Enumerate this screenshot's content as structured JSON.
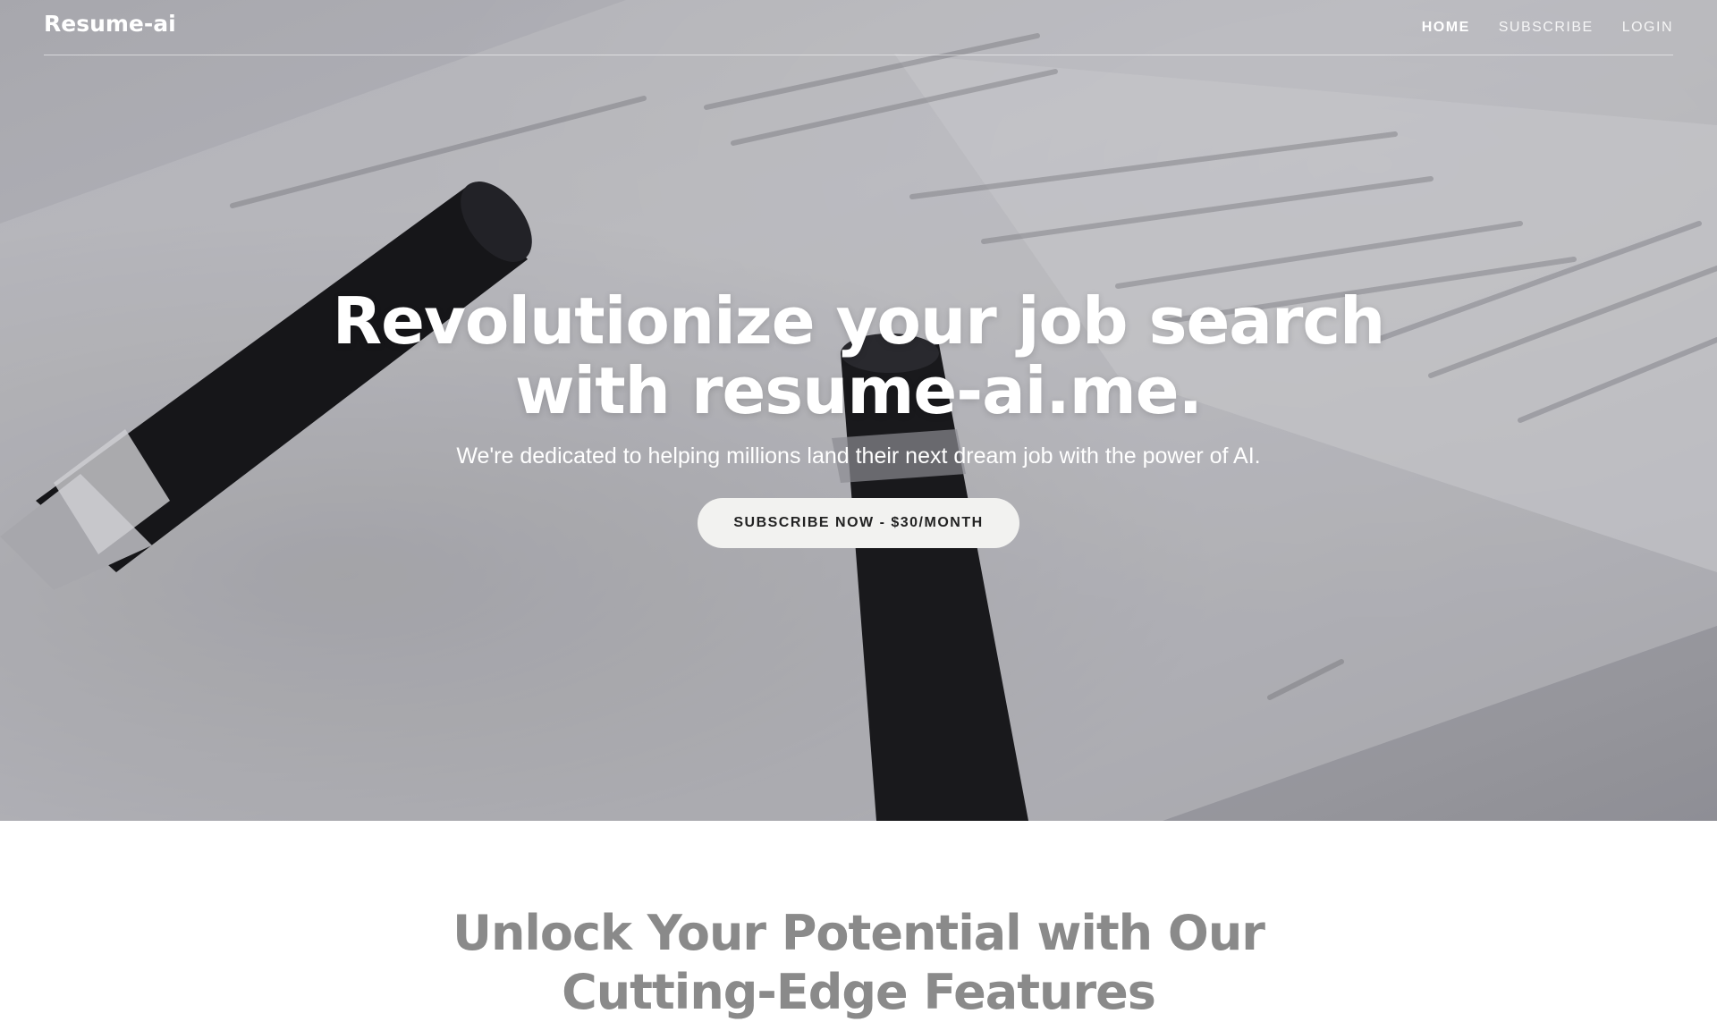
{
  "brand": {
    "name": "Resume-ai"
  },
  "nav": {
    "items": [
      {
        "label": "HOME",
        "active": true
      },
      {
        "label": "SUBSCRIBE",
        "active": false
      },
      {
        "label": "LOGIN",
        "active": false
      }
    ]
  },
  "hero": {
    "title": "Revolutionize your job search with resume-ai.me.",
    "subtitle": "We're dedicated to helping millions land their next dream job with the power of AI.",
    "cta_label": "SUBSCRIBE NOW - $30/MONTH",
    "background": "photo of two black pens lying on printed resume pages"
  },
  "features": {
    "title": "Unlock Your Potential with Our Cutting-Edge Features"
  },
  "colors": {
    "hero_text": "#ffffff",
    "cta_bg": "#f2f2f0",
    "cta_text": "#222222",
    "features_title": "#8a8a8a",
    "page_bg": "#ffffff"
  }
}
